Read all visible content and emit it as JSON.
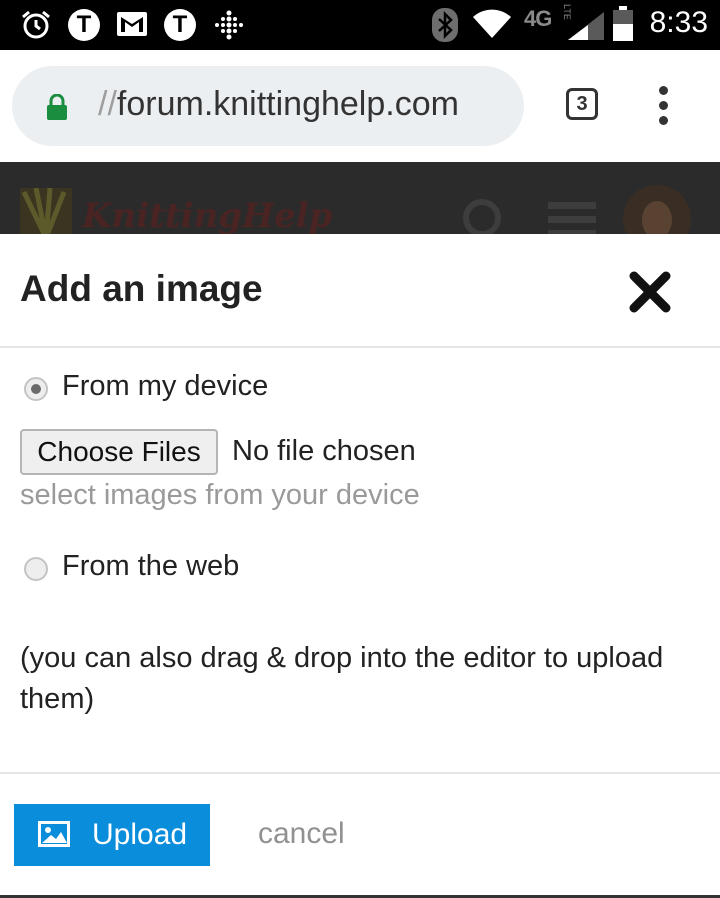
{
  "status_bar": {
    "time": "8:33",
    "network_label": "4G",
    "lte_label": "LTE",
    "tab_t_letter": "T",
    "icons": [
      "alarm-icon",
      "t-app-icon",
      "gmail-icon",
      "t-app-icon",
      "fitbit-icon",
      "bluetooth-icon",
      "wifi-icon",
      "signal-icon",
      "battery-icon"
    ]
  },
  "browser": {
    "url_prefix": "//",
    "url_host": "forum.knittinghelp.com",
    "tab_count": "3",
    "lock_color": "#1a8d3f"
  },
  "site": {
    "logo_text": "KnittingHelp"
  },
  "modal": {
    "title": "Add an image",
    "options": {
      "device_label": "From my device",
      "web_label": "From the web",
      "device_selected": true
    },
    "file_input": {
      "button_label": "Choose Files",
      "status": "No file chosen",
      "hint": "select images from your device"
    },
    "drag_drop_note": "(you can also drag & drop into the editor to upload them)",
    "footer": {
      "upload_label": "Upload",
      "cancel_label": "cancel",
      "upload_color": "#0a8ddb"
    }
  }
}
